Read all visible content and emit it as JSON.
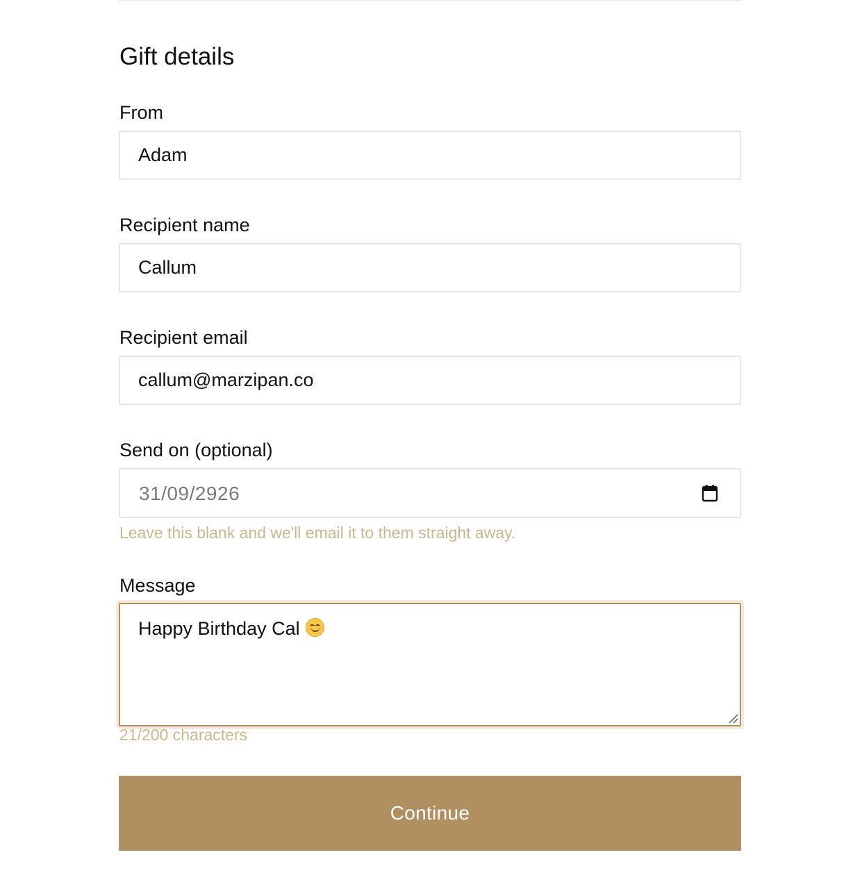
{
  "section": {
    "title": "Gift details"
  },
  "from": {
    "label": "From",
    "value": "Adam"
  },
  "recipient_name": {
    "label": "Recipient name",
    "value": "Callum"
  },
  "recipient_email": {
    "label": "Recipient email",
    "value": "callum@marzipan.co"
  },
  "send_on": {
    "label": "Send on (optional)",
    "value": "31/09/2926",
    "icon": "calendar-icon",
    "helper": "Leave this blank and we'll email it to them straight away."
  },
  "message": {
    "label": "Message",
    "value": "Happy Birthday Cal",
    "emoji_icon": "smiling-face-icon",
    "counter": "21/200 characters"
  },
  "actions": {
    "continue_label": "Continue"
  },
  "colors": {
    "accent": "#b09060",
    "helper_text": "#c9b88c",
    "input_border": "#e6e6e6",
    "focus_ring": "#f5e9dd"
  }
}
